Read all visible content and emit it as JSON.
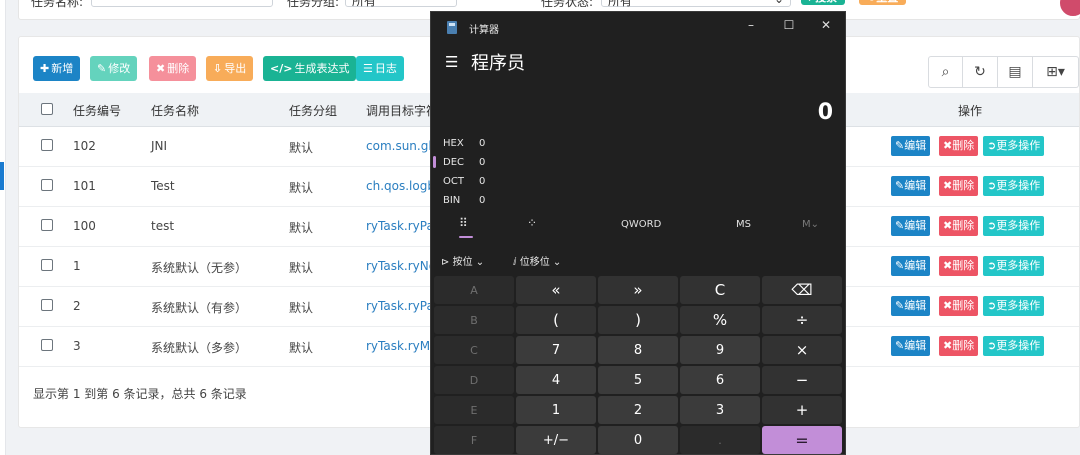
{
  "search": {
    "task_name_label": "任务名称:",
    "task_group_label": "任务分组:",
    "task_group_value": "所有",
    "task_status_label": "任务状态:",
    "task_status_value": "所有",
    "search_button": "搜索",
    "reset_button": "重置"
  },
  "toolbar": {
    "add": "新增",
    "edit": "修改",
    "delete": "删除",
    "export": "导出",
    "expression": "生成表达式",
    "log": "日志"
  },
  "table": {
    "headers": [
      "任务编号",
      "任务名称",
      "任务分组",
      "调用目标字符",
      "操作"
    ],
    "rows": [
      {
        "id": "102",
        "name": "JNI",
        "group": "默认",
        "target": "com.sun.gla"
      },
      {
        "id": "101",
        "name": "Test",
        "group": "默认",
        "target": "ch.qos.logba"
      },
      {
        "id": "100",
        "name": "test",
        "group": "默认",
        "target": "ryTask.ryPar"
      },
      {
        "id": "1",
        "name": "系统默认（无参）",
        "group": "默认",
        "target": "ryTask.ryNo"
      },
      {
        "id": "2",
        "name": "系统默认（有参）",
        "group": "默认",
        "target": "ryTask.ryPar"
      },
      {
        "id": "3",
        "name": "系统默认（多参）",
        "group": "默认",
        "target": "ryTask.ryMu"
      }
    ],
    "actions": {
      "edit": "编辑",
      "delete": "删除",
      "more": "更多操作"
    },
    "pager_text": "显示第 1 到第 6 条记录，总共 6 条记录"
  },
  "calculator": {
    "window_title": "计算器",
    "mode": "程序员",
    "display": "0",
    "radix": [
      {
        "label": "HEX",
        "value": "0"
      },
      {
        "label": "DEC",
        "value": "0"
      },
      {
        "label": "OCT",
        "value": "0"
      },
      {
        "label": "BIN",
        "value": "0"
      }
    ],
    "word_size": "QWORD",
    "memory_store": "MS",
    "memory_menu": "M",
    "bitwise": "按位",
    "bitshift": "位移位",
    "keys": [
      "A",
      "«",
      "»",
      "C",
      "⌫",
      "B",
      "(",
      ")",
      "%",
      "÷",
      "C",
      "7",
      "8",
      "9",
      "×",
      "D",
      "4",
      "5",
      "6",
      "−",
      "E",
      "1",
      "2",
      "3",
      "+",
      "F",
      "+/−",
      "0",
      ".",
      "="
    ]
  },
  "colors": {
    "accent": "#c28ed8",
    "primary": "#1c84c6",
    "danger": "#ed5565",
    "info": "#23c6c8",
    "warning": "#f8ac59",
    "success": "#1ab394"
  }
}
